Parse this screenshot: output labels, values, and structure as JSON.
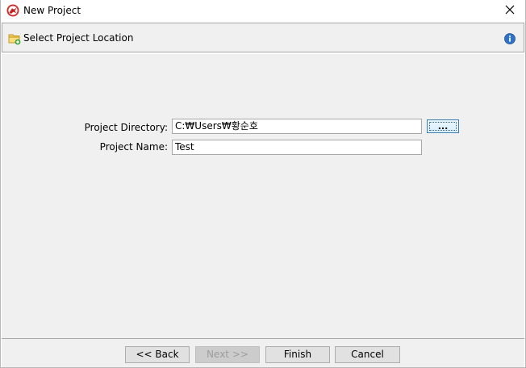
{
  "window": {
    "title": "New Project",
    "app_icon": "red-bird-logo-icon",
    "close_icon": "close-icon"
  },
  "header": {
    "title": "Select Project Location",
    "icon": "new-folder-icon",
    "help_icon": "info-icon"
  },
  "form": {
    "directory_label": "Project Directory:",
    "directory_value": "C:₩Users₩황순호",
    "browse_label": "...",
    "name_label": "Project Name:",
    "name_value": "Test"
  },
  "buttons": {
    "back": "<< Back",
    "next": "Next >>",
    "finish": "Finish",
    "cancel": "Cancel"
  },
  "colors": {
    "panel_bg": "#f0f0f0",
    "button_bg": "#e1e1e1",
    "disabled_button_bg": "#cccccc",
    "focus_blue": "#3c7fb1"
  }
}
